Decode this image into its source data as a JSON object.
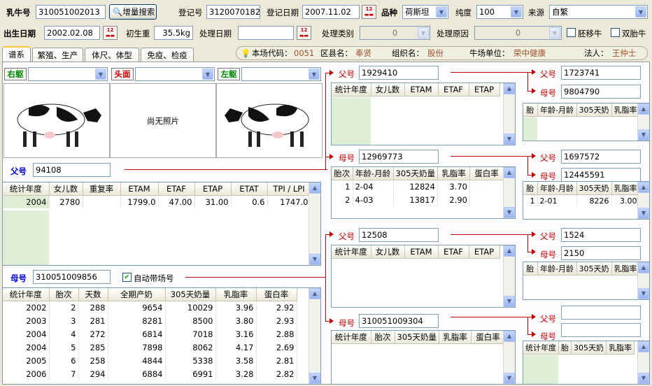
{
  "top": {
    "ear_label": "乳牛号",
    "ear_value": "310051002013",
    "search_btn": "增量搜索",
    "reg_label": "登记号",
    "reg_value": "3120070182",
    "regdate_label": "登记日期",
    "regdate_value": "2007.11.02",
    "breed_label": "品种",
    "breed_value": "荷斯坦",
    "purity_label": "纯度",
    "purity_value": "100",
    "source_label": "来源",
    "source_value": "自繁"
  },
  "row2": {
    "birth_label": "出生日期",
    "birth_value": "2002.02.08",
    "bw_label": "初生重",
    "bw_value": "35.5kg",
    "dispdate_label": "处理日期",
    "disptype_label": "处理类别",
    "disptype_value": "0",
    "dispreason_label": "处理原因",
    "dispreason_value": "0",
    "embryo_label": "胚移牛",
    "twin_label": "双胎牛"
  },
  "tabs": [
    "谱系",
    "繁殖、生产",
    "体尺、体型",
    "免疫、检疫"
  ],
  "info": {
    "farm_code_label": "本场代码：",
    "farm_code": "0051",
    "district_label": "区县名：",
    "district": "奉贤",
    "org_label": "组织名：",
    "org": "股份",
    "farm_unit_label": "牛场单位：",
    "farm_unit": "荣中健康",
    "legal_label": "法人：",
    "legal": "王仲士"
  },
  "photos": {
    "right": "右躯",
    "head": "头面",
    "left": "左躯",
    "no_photo": "尚无照片"
  },
  "sire": {
    "label": "父号",
    "value": "94108",
    "cols": [
      "统计年度",
      "女儿数",
      "重复率",
      "ETAM",
      "ETAF",
      "ETAP",
      "ETAT",
      "TPI / LPI"
    ],
    "rows": [
      [
        "2004",
        "2780",
        "",
        "1799.0",
        "47.00",
        "31.00",
        "0.6",
        "1747.0"
      ]
    ]
  },
  "dam": {
    "label": "母号",
    "value": "310051009856",
    "auto_label": "自动带场号",
    "cols": [
      "统计年度",
      "胎次",
      "天数",
      "全期产奶",
      "305天奶量",
      "乳脂率",
      "蛋白率"
    ],
    "rows": [
      [
        "2002",
        "2",
        "288",
        "9654",
        "10029",
        "3.96",
        "2.92"
      ],
      [
        "2003",
        "3",
        "281",
        "8281",
        "8500",
        "3.80",
        "2.93"
      ],
      [
        "2004",
        "4",
        "272",
        "6814",
        "7018",
        "3.16",
        "2.88"
      ],
      [
        "2004",
        "5",
        "285",
        "7898",
        "8062",
        "4.17",
        "2.69"
      ],
      [
        "2005",
        "6",
        "258",
        "4844",
        "5338",
        "3.58",
        "2.81"
      ],
      [
        "2006",
        "7",
        "294",
        "6884",
        "6991",
        "3.28",
        "2.82"
      ]
    ]
  },
  "ss": {
    "label": "父号",
    "value": "1929410",
    "cols": [
      "统计年度",
      "女儿数",
      "ETAM",
      "ETAF",
      "ETAP"
    ]
  },
  "sss": {
    "label": "父号",
    "value": "1723741"
  },
  "ssd": {
    "label": "母号",
    "value": "9804790",
    "cols": [
      "胎",
      "年龄-月龄",
      "305天奶",
      "乳脂率"
    ]
  },
  "sd": {
    "label": "母号",
    "value": "12969773",
    "cols": [
      "胎次",
      "年龄-月龄",
      "305天奶量",
      "乳脂率",
      "蛋白率"
    ],
    "rows": [
      [
        "1",
        "2-04",
        "12824",
        "3.70",
        ""
      ],
      [
        "2",
        "4-03",
        "13817",
        "2.90",
        ""
      ]
    ]
  },
  "sds": {
    "label": "父号",
    "value": "1697572"
  },
  "sdd": {
    "label": "母号",
    "value": "12445591",
    "cols": [
      "胎",
      "年龄-月龄",
      "305天奶",
      "乳脂率"
    ],
    "rows": [
      [
        "1",
        "2-01",
        "8226",
        "3.00"
      ]
    ]
  },
  "ds": {
    "label": "父号",
    "value": "12508",
    "cols": [
      "统计年度",
      "女儿数",
      "ETAM",
      "ETAF",
      "ETAP"
    ]
  },
  "dss": {
    "label": "父号",
    "value": "1524"
  },
  "dsd": {
    "label": "母号",
    "value": "2150",
    "cols": [
      "胎",
      "年龄-月龄",
      "305天奶",
      "乳脂率"
    ]
  },
  "dd": {
    "label": "母号",
    "value": "310051009304",
    "cols": [
      "统计年度",
      "胎次",
      "305天奶量",
      "乳脂率",
      "蛋白率"
    ]
  },
  "dds": {
    "label": "父号",
    "value": ""
  },
  "ddd": {
    "label": "母号",
    "value": "",
    "cols": [
      "统计年度",
      "胎",
      "305天奶",
      "乳脂率"
    ]
  }
}
